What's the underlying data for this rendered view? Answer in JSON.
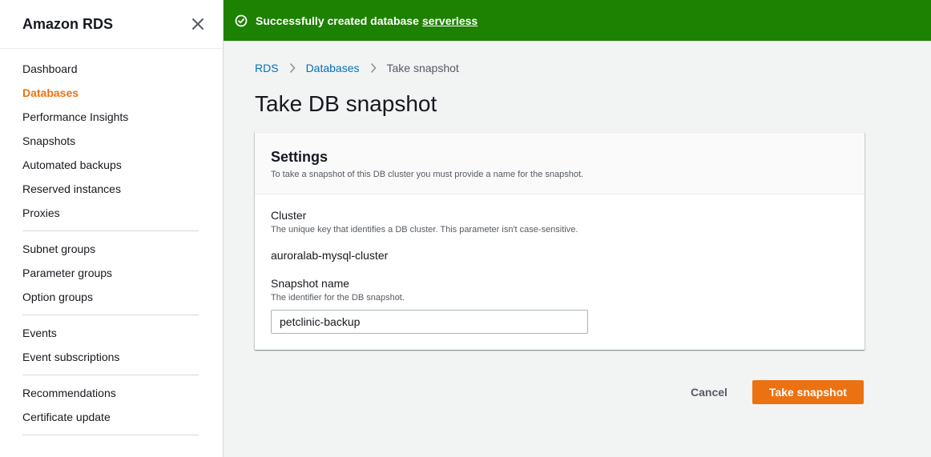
{
  "sidebar": {
    "title": "Amazon RDS",
    "close_icon": "close-icon",
    "groups": [
      [
        "Dashboard",
        "Databases",
        "Performance Insights",
        "Snapshots",
        "Automated backups",
        "Reserved instances",
        "Proxies"
      ],
      [
        "Subnet groups",
        "Parameter groups",
        "Option groups"
      ],
      [
        "Events",
        "Event subscriptions"
      ],
      [
        "Recommendations",
        "Certificate update"
      ]
    ],
    "active_item": "Databases"
  },
  "flash": {
    "icon": "check-circle-icon",
    "message": "Successfully created database",
    "link_text": "serverless",
    "color": "#1d8102"
  },
  "breadcrumb": {
    "items": [
      "RDS",
      "Databases"
    ],
    "current": "Take snapshot"
  },
  "page": {
    "title": "Take DB snapshot"
  },
  "settings": {
    "title": "Settings",
    "description": "To take a snapshot of this DB cluster you must provide a name for the snapshot.",
    "cluster": {
      "label": "Cluster",
      "description": "The unique key that identifies a DB cluster. This parameter isn't case-sensitive.",
      "value": "auroralab-mysql-cluster"
    },
    "snapshot_name": {
      "label": "Snapshot name",
      "description": "The identifier for the DB snapshot.",
      "value": "petclinic-backup"
    }
  },
  "actions": {
    "cancel": "Cancel",
    "submit": "Take snapshot",
    "accent": "#ec7211"
  }
}
